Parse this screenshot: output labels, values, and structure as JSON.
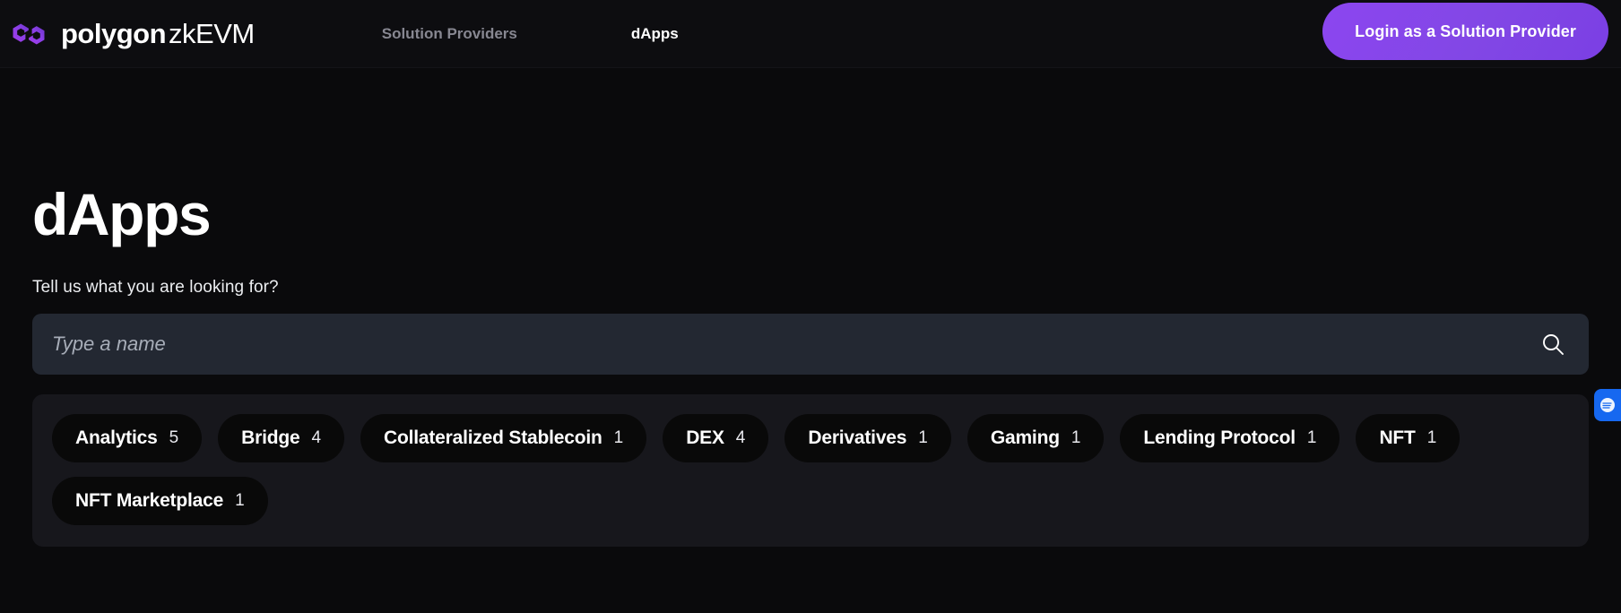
{
  "header": {
    "brand": {
      "bold": "polygon",
      "light": "zkEVM",
      "logo_icon": "polygon-logo-icon"
    },
    "nav": [
      {
        "label": "Solution Providers",
        "active": false
      },
      {
        "label": "dApps",
        "active": true
      }
    ],
    "login_button": "Login as a Solution Provider"
  },
  "main": {
    "title": "dApps",
    "subtitle": "Tell us what you are looking for?",
    "search": {
      "placeholder": "Type a name",
      "value": "",
      "icon": "search-icon"
    },
    "filters": [
      {
        "label": "Analytics",
        "count": "5"
      },
      {
        "label": "Bridge",
        "count": "4"
      },
      {
        "label": "Collateralized Stablecoin",
        "count": "1"
      },
      {
        "label": "DEX",
        "count": "4"
      },
      {
        "label": "Derivatives",
        "count": "1"
      },
      {
        "label": "Gaming",
        "count": "1"
      },
      {
        "label": "Lending Protocol",
        "count": "1"
      },
      {
        "label": "NFT",
        "count": "1"
      },
      {
        "label": "NFT Marketplace",
        "count": "1"
      }
    ]
  },
  "side_widget": {
    "icon": "chat-widget-icon"
  },
  "colors": {
    "background": "#0a0a0c",
    "header_background": "#0d0d10",
    "accent_purple": "#8247e5",
    "search_background": "#232832",
    "panel_background": "#17171c",
    "chip_background": "#090909",
    "muted_text": "#878791",
    "widget_blue": "#1668f0"
  }
}
